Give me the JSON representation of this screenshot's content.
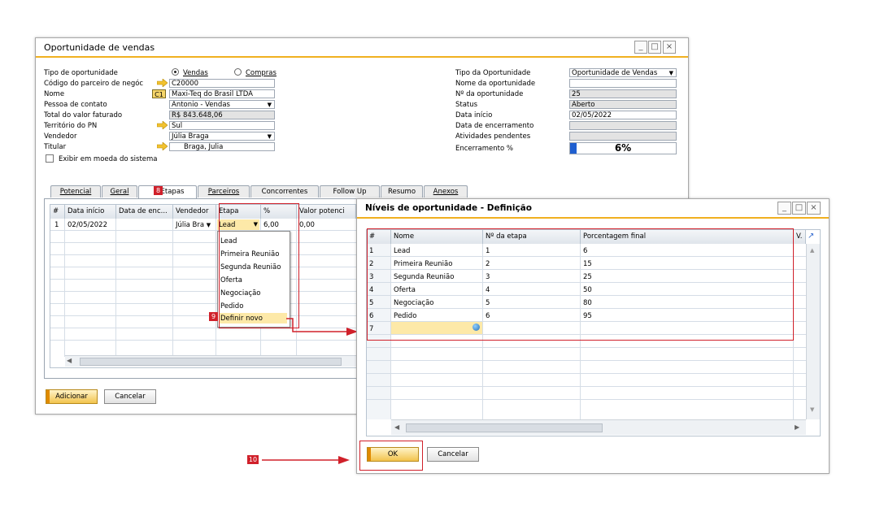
{
  "main": {
    "title": "Oportunidade de vendas",
    "left_fields": [
      {
        "label": "Tipo de oportunidade"
      },
      {
        "label": "Código do parceiro de negóc",
        "value": "C20000"
      },
      {
        "label": "Nome",
        "value": "Maxi-Teq do Brasil LTDA",
        "badge": "C1"
      },
      {
        "label": "Pessoa de contato",
        "value": "Antonio - Vendas"
      },
      {
        "label": "Total do valor faturado",
        "value": "R$ 843.648,06"
      },
      {
        "label": "Território do PN",
        "value": "Sul"
      },
      {
        "label": "Vendedor",
        "value": "Júlia Braga"
      },
      {
        "label": "Titular",
        "value": "Braga, Julia"
      }
    ],
    "radio_vendas": "Vendas",
    "radio_compras": "Compras",
    "checkbox_label": "Exibir em moeda do sistema",
    "right_fields": [
      {
        "label": "Tipo da Oportunidade",
        "value": "Oportunidade de Vendas"
      },
      {
        "label": "Nome da oportunidade",
        "value": ""
      },
      {
        "label": "Nº da oportunidade",
        "value": "25"
      },
      {
        "label": "Status",
        "value": "Aberto"
      },
      {
        "label": "Data início",
        "value": "02/05/2022"
      },
      {
        "label": "Data de encerramento",
        "value": ""
      },
      {
        "label": "Atividades pendentes",
        "value": ""
      },
      {
        "label": "Encerramento %",
        "value": "6%",
        "progress": 0.06
      }
    ],
    "tabs": [
      "Potencial",
      "Geral",
      "Etapas",
      "Parceiros",
      "Concorrentes",
      "Follow Up",
      "Resumo",
      "Anexos"
    ],
    "grid_headers": [
      "#",
      "Data início",
      "Data de enc...",
      "Vendedor",
      "Etapa",
      "%",
      "Valor potenci"
    ],
    "grid_row": {
      "num": "1",
      "data_inicio": "02/05/2022",
      "data_enc": "",
      "vendedor": "Júlia Bra",
      "etapa": "Lead",
      "pct": "6,00",
      "valor": "0,00"
    },
    "dropdown_items": [
      "Lead",
      "Primeira Reunião",
      "Segunda Reunião",
      "Oferta",
      "Negociação",
      "Pedido",
      "Definir novo"
    ],
    "btn_add": "Adicionar",
    "btn_cancel": "Cancelar"
  },
  "dialog": {
    "title": "Níveis de oportunidade - Definição",
    "headers": [
      "#",
      "Nome",
      "Nº da etapa",
      "Porcentagem final",
      "V."
    ],
    "rows": [
      {
        "num": "1",
        "nome": "Lead",
        "etapa": "1",
        "pct": "6"
      },
      {
        "num": "2",
        "nome": "Primeira Reunião",
        "etapa": "2",
        "pct": "15"
      },
      {
        "num": "3",
        "nome": "Segunda Reunião",
        "etapa": "3",
        "pct": "25"
      },
      {
        "num": "4",
        "nome": "Oferta",
        "etapa": "4",
        "pct": "50"
      },
      {
        "num": "5",
        "nome": "Negociação",
        "etapa": "5",
        "pct": "80"
      },
      {
        "num": "6",
        "nome": "Pedido",
        "etapa": "6",
        "pct": "95"
      },
      {
        "num": "7",
        "nome": "",
        "etapa": "",
        "pct": ""
      }
    ],
    "btn_ok": "OK",
    "btn_cancel": "Cancelar"
  },
  "callouts": {
    "badge8": "8",
    "badge9": "9",
    "badge10": "10"
  }
}
